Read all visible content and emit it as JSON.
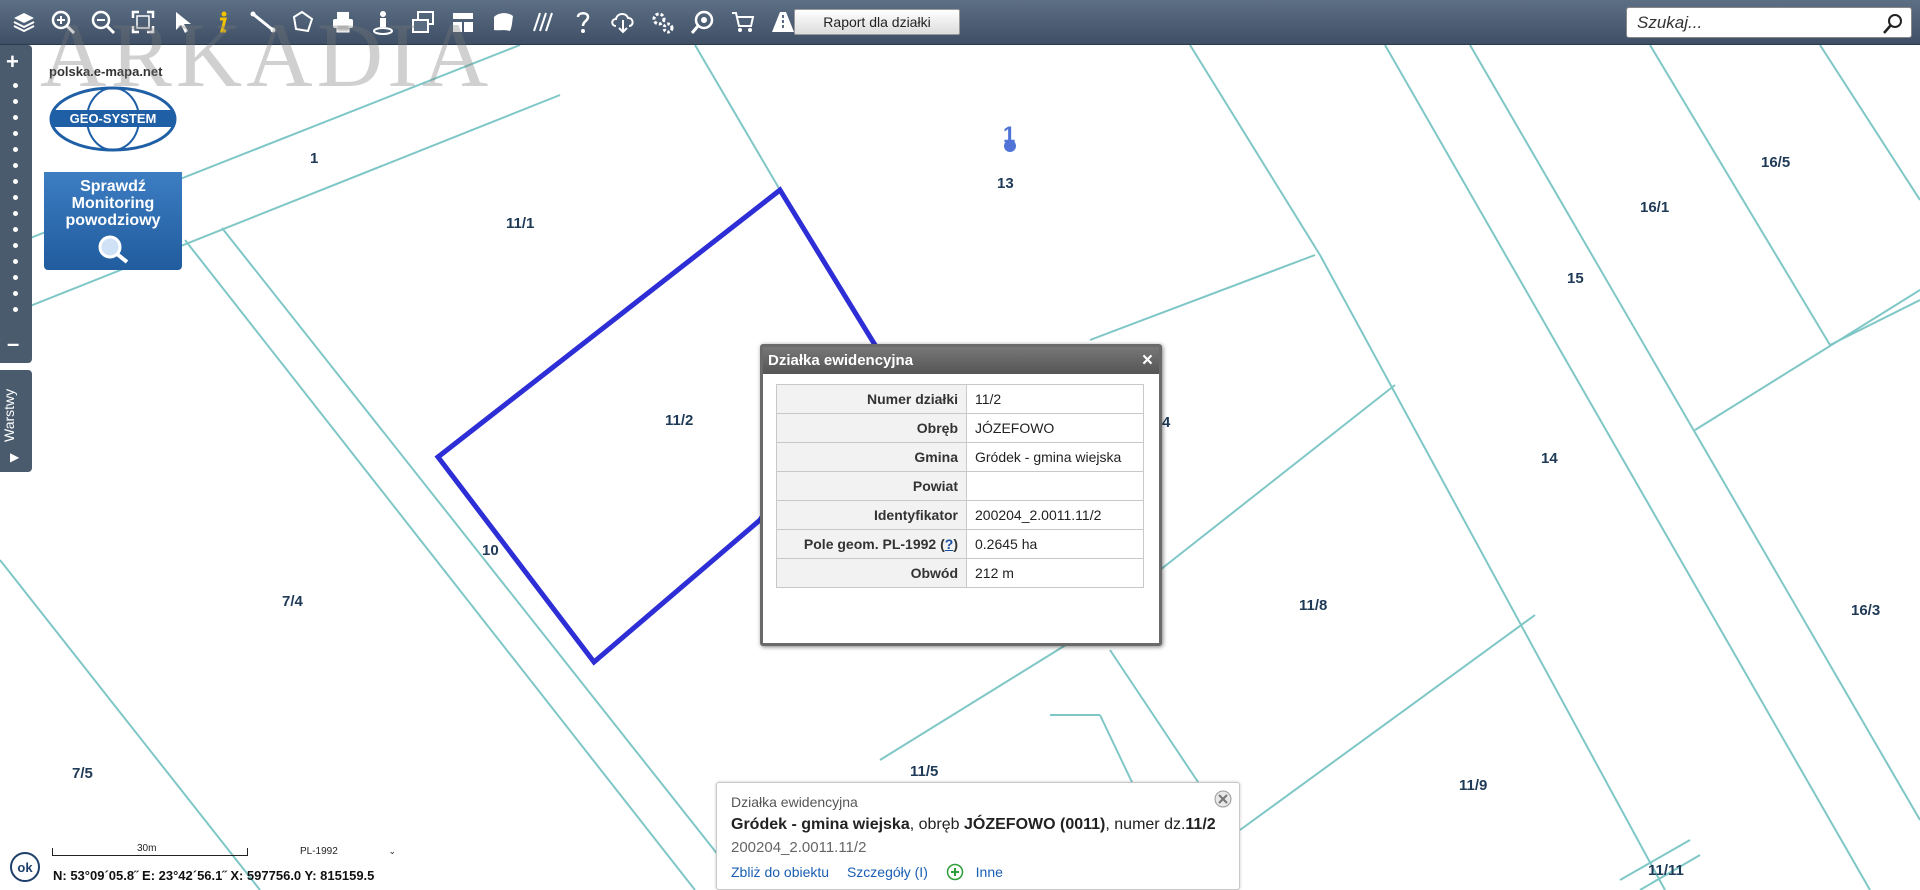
{
  "toolbar": {
    "report_button": "Raport dla działki",
    "search_placeholder": "Szukaj..."
  },
  "watermark": "ARKADIA",
  "left_panel": {
    "layers_tab_label": "Warstwy"
  },
  "logo": {
    "url_text": "polska.e-mapa.net",
    "brand": "GEO-SYSTEM",
    "panel_text": "Sprawdź\nMonitoring\npowodziowy"
  },
  "map": {
    "parcel_labels": [
      "1",
      "11/1",
      "11/2",
      "10",
      "7/4",
      "7/5",
      "13",
      "15",
      "16/1",
      "16/5",
      "14",
      "11/8",
      "16/3",
      "11/5",
      "11/9",
      "11/11",
      "4"
    ],
    "point_marker_label": "1"
  },
  "popup": {
    "title": "Działka ewidencyjna",
    "close": "×",
    "rows": [
      {
        "key": "Numer działki",
        "value": "11/2"
      },
      {
        "key": "Obręb",
        "value": "JÓZEFOWO"
      },
      {
        "key": "Gmina",
        "value": "Gródek - gmina wiejska"
      },
      {
        "key": "Powiat",
        "value": ""
      },
      {
        "key": "Identyfikator",
        "value": "200204_2.0011.11/2"
      },
      {
        "key": "Pole geom. PL-1992",
        "value": "0.2645 ha"
      },
      {
        "key": "Obwód",
        "value": "212 m"
      }
    ],
    "help_mark": "?"
  },
  "bottom_info": {
    "title": "Działka ewidencyjna",
    "gmina": "Gródek - gmina wiejska",
    "obreb_prefix": ", obręb ",
    "obreb": "JÓZEFOWO (0011)",
    "numer_prefix": ", numer dz.",
    "numer": "11/2",
    "identifier": "200204_2.0011.11/2",
    "link_zoom": "Zbliż do obiektu",
    "link_details": "Szczegóły (I)",
    "link_other": "Inne"
  },
  "status": {
    "ok_button": "ok",
    "scale_label": "30m",
    "crs": "PL-1992",
    "coordinates": "N: 53°09´05.8˝ E: 23°42´56.1˝ X: 597756.0  Y: 815159.5"
  },
  "colors": {
    "parcel_lines": "#7fc7c7",
    "selected_parcel": "#2e2ed6",
    "toolbar": "#4b5b6e",
    "label_text": "#1f3a57"
  }
}
